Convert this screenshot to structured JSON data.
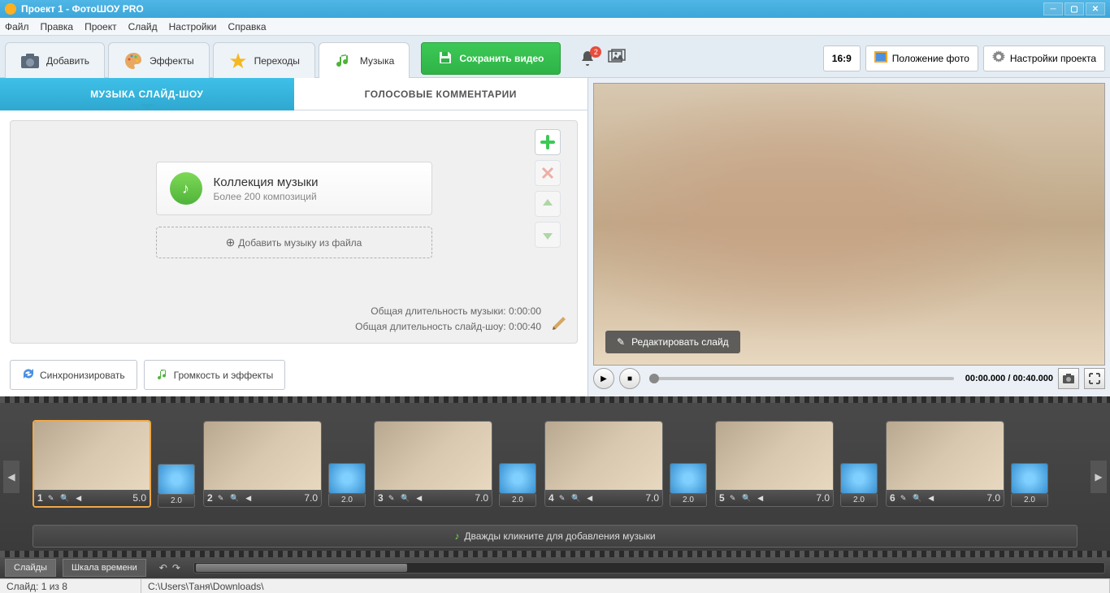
{
  "window": {
    "title": "Проект 1 - ФотоШОУ PRO"
  },
  "menu": [
    "Файл",
    "Правка",
    "Проект",
    "Слайд",
    "Настройки",
    "Справка"
  ],
  "tabs": {
    "add": "Добавить",
    "effects": "Эффекты",
    "transitions": "Переходы",
    "music": "Музыка"
  },
  "save_btn": "Сохранить видео",
  "notif_count": "2",
  "aspect": "16:9",
  "layout_btn": "Положение фото",
  "settings_btn": "Настройки проекта",
  "sub_tabs": {
    "music_slideshow": "МУЗЫКА СЛАЙД-ШОУ",
    "voice_comments": "ГОЛОСОВЫЕ КОММЕНТАРИИ"
  },
  "music": {
    "collection_title": "Коллекция музыки",
    "collection_sub": "Более 200 композиций",
    "add_from_file": "Добавить музыку из файла",
    "total_music": "Общая длительность музыки: 0:00:00",
    "total_slideshow": "Общая длительность слайд-шоу: 0:00:40"
  },
  "actions": {
    "sync": "Синхронизировать",
    "volume": "Громкость и эффекты"
  },
  "preview": {
    "edit_slide": "Редактировать слайд",
    "time": "00:00.000 / 00:40.000"
  },
  "timeline": {
    "music_hint": "Дважды кликните для добавления музыки",
    "slides": [
      {
        "n": "1",
        "dur": "5.0",
        "trans": "2.0",
        "selected": true
      },
      {
        "n": "2",
        "dur": "7.0",
        "trans": "2.0"
      },
      {
        "n": "3",
        "dur": "7.0",
        "trans": "2.0"
      },
      {
        "n": "4",
        "dur": "7.0",
        "trans": "2.0"
      },
      {
        "n": "5",
        "dur": "7.0",
        "trans": "2.0"
      },
      {
        "n": "6",
        "dur": "7.0",
        "trans": "2.0"
      }
    ]
  },
  "view": {
    "slides": "Слайды",
    "timeline": "Шкала времени"
  },
  "status": {
    "slide": "Слайд: 1 из 8",
    "path": "C:\\Users\\Таня\\Downloads\\"
  }
}
